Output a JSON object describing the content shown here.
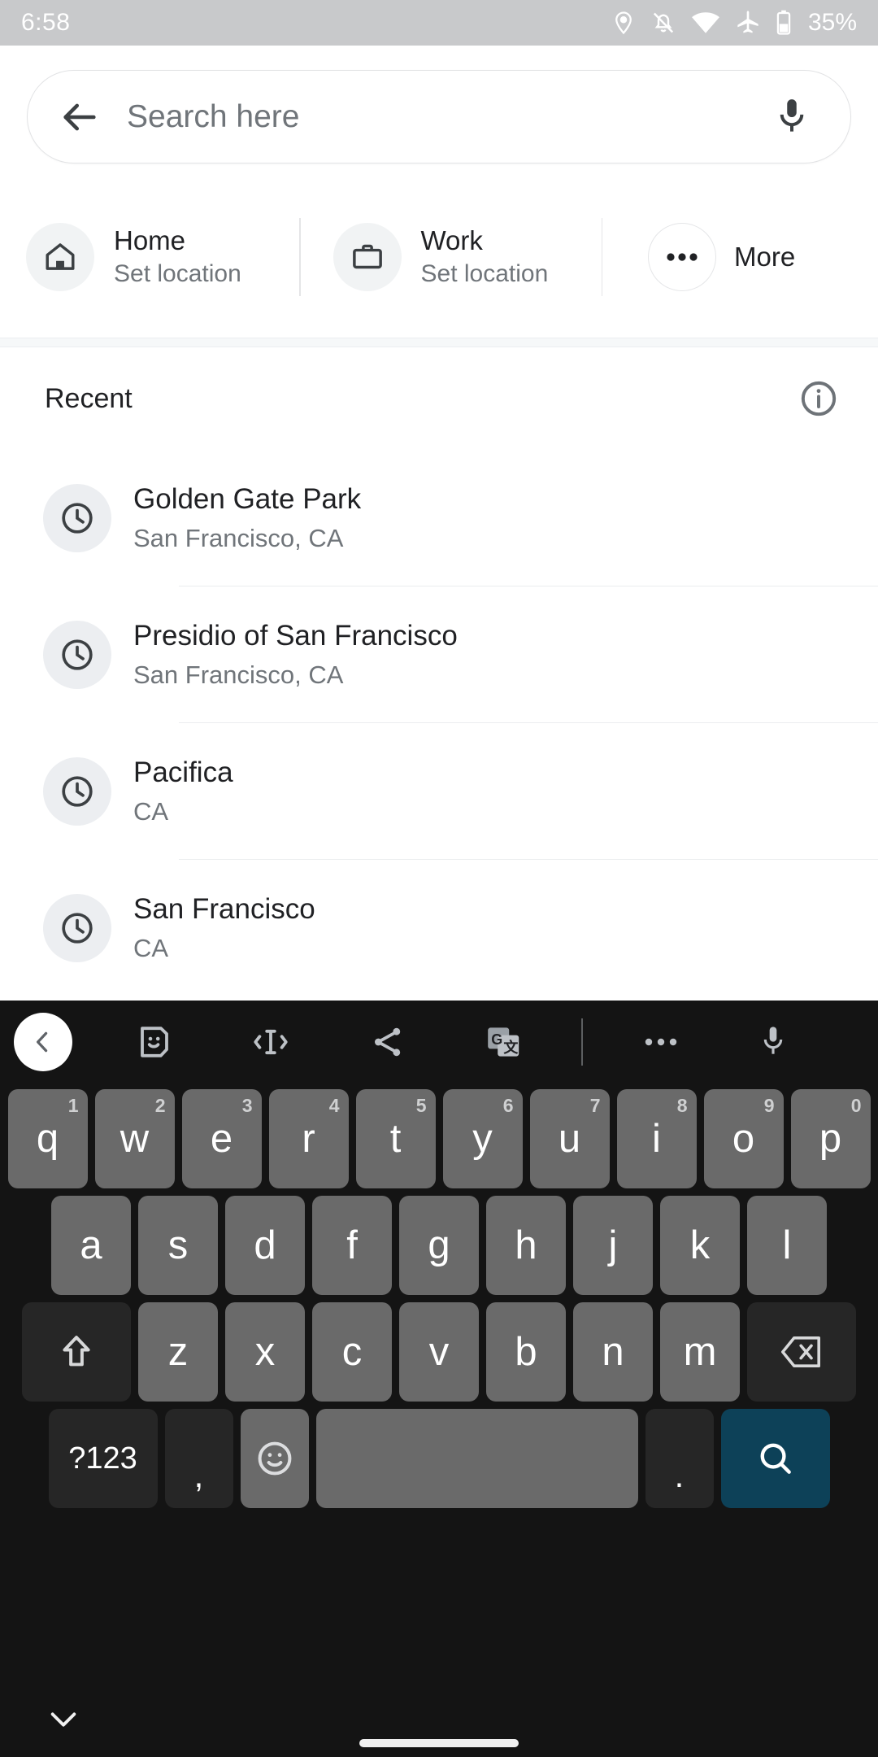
{
  "status_bar": {
    "time": "6:58",
    "battery_percent": "35%",
    "icons": [
      "location-pin-icon",
      "notifications-off-icon",
      "wifi-icon",
      "airplane-mode-icon",
      "battery-icon"
    ],
    "background_color": "#c8c9cb",
    "foreground_color": "#ffffff"
  },
  "search": {
    "placeholder": "Search here",
    "value": "",
    "back_icon": "arrow-back-icon",
    "voice_icon": "microphone-icon"
  },
  "shortcuts": [
    {
      "icon": "home-icon",
      "title": "Home",
      "subtitle": "Set location"
    },
    {
      "icon": "work-briefcase-icon",
      "title": "Work",
      "subtitle": "Set location"
    },
    {
      "icon": "more-dots-icon",
      "title": "More",
      "subtitle": ""
    }
  ],
  "recent": {
    "section_title": "Recent",
    "info_icon": "info-circle-icon",
    "items": [
      {
        "icon": "clock-history-icon",
        "name": "Golden Gate Park",
        "subtitle": "San Francisco, CA"
      },
      {
        "icon": "clock-history-icon",
        "name": "Presidio of San Francisco",
        "subtitle": "San Francisco, CA"
      },
      {
        "icon": "clock-history-icon",
        "name": "Pacifica",
        "subtitle": "CA"
      },
      {
        "icon": "clock-history-icon",
        "name": "San Francisco",
        "subtitle": "CA"
      }
    ]
  },
  "keyboard": {
    "toolbar": [
      "chevron-left-icon",
      "sticker-icon",
      "clipboard-cursor-icon",
      "share-icon",
      "google-translate-icon",
      "overflow-dots-icon",
      "microphone-icon"
    ],
    "row1": [
      {
        "label": "q",
        "num": "1"
      },
      {
        "label": "w",
        "num": "2"
      },
      {
        "label": "e",
        "num": "3"
      },
      {
        "label": "r",
        "num": "4"
      },
      {
        "label": "t",
        "num": "5"
      },
      {
        "label": "y",
        "num": "6"
      },
      {
        "label": "u",
        "num": "7"
      },
      {
        "label": "i",
        "num": "8"
      },
      {
        "label": "o",
        "num": "9"
      },
      {
        "label": "p",
        "num": "0"
      }
    ],
    "row2": [
      {
        "label": "a"
      },
      {
        "label": "s"
      },
      {
        "label": "d"
      },
      {
        "label": "f"
      },
      {
        "label": "g"
      },
      {
        "label": "h"
      },
      {
        "label": "j"
      },
      {
        "label": "k"
      },
      {
        "label": "l"
      }
    ],
    "row3": [
      {
        "label": "",
        "icon": "shift-icon",
        "style": "dark"
      },
      {
        "label": "z"
      },
      {
        "label": "x"
      },
      {
        "label": "c"
      },
      {
        "label": "v"
      },
      {
        "label": "b"
      },
      {
        "label": "n"
      },
      {
        "label": "m"
      },
      {
        "label": "",
        "icon": "backspace-icon",
        "style": "dark"
      }
    ],
    "row4": {
      "symbols": "?123",
      "comma": ",",
      "emoji_icon": "emoji-smiley-icon",
      "space": "",
      "period": ".",
      "enter_icon": "search-magnifier-icon"
    },
    "colors": {
      "background": "#141414",
      "key": "#6a6a6a",
      "key_dark": "#262626",
      "key_accent": "#0d4158",
      "key_text": "#ffffff"
    }
  },
  "navbar": {
    "dismiss_icon": "chevron-down-icon",
    "home_indicator": "home-indicator"
  }
}
